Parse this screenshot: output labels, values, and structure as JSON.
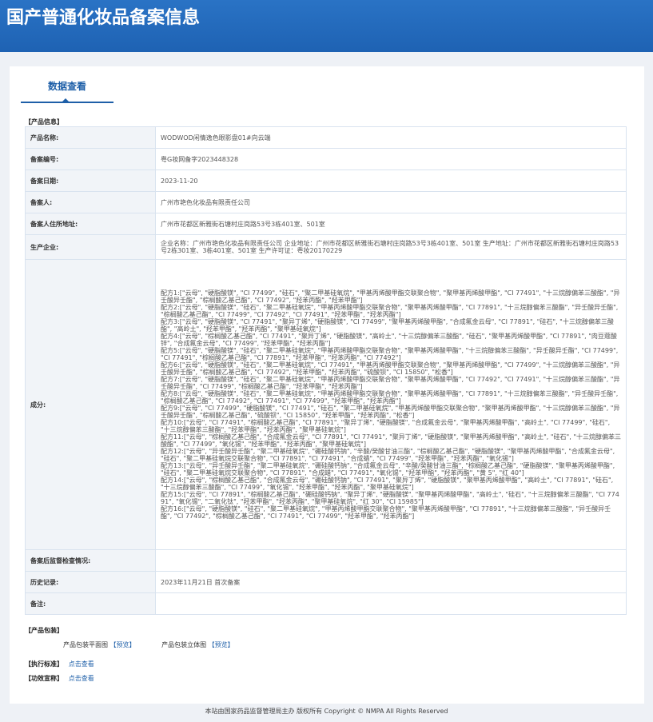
{
  "header": {
    "title": "国产普通化妆品备案信息"
  },
  "tab": {
    "label": "数据查看"
  },
  "sections": {
    "product_info": "【产品信息】",
    "product_package": "【产品包装】",
    "exec_standard": "【执行标准】",
    "efficacy": "【功效宣称】"
  },
  "rows": {
    "product_name": {
      "label": "产品名称:",
      "value": "WODWOD闲情逸色眼影盘01#向云端"
    },
    "record_no": {
      "label": "备案编号:",
      "value": "粤G妆网备字2023448328"
    },
    "record_date": {
      "label": "备案日期:",
      "value": "2023-11-20"
    },
    "registrant": {
      "label": "备案人:",
      "value": "广州市艳色化妆品有限责任公司"
    },
    "registrant_address": {
      "label": "备案人住所地址:",
      "value": "广州市花都区新雅街石塘村庄岗路53号3栋401室、501室"
    },
    "manufacturer": {
      "label": "生产企业:",
      "value": "企业名称：广州市艳色化妆品有限责任公司 企业地址：广州市花都区新雅街石塘村庄岗路53号3栋401室、501室 生产地址：广州市花都区新雅街石塘村庄岗路53号2栋301室、3栋401室、501室 生产许可证：粤妆20170229"
    },
    "ingredients": {
      "label": "成分:",
      "value": "配方1:[\"云母\", \"硬脂酸镁\", \"CI 77499\", \"硅石\", \"聚二甲基硅氧烷\", \"甲基丙烯酸甲酯交联聚合物\", \"聚甲基丙烯酸甲酯\", \"CI 77491\", \"十三烷醇偏苯三酸酯\", \"异壬酸异壬酯\", \"棕榈酸乙基己酯\", \"CI 77492\", \"羟苯丙酯\", \"羟苯甲酯\"]\n配方2:[\"云母\", \"硬脂酸镁\", \"硅石\", \"聚二甲基硅氧烷\", \"甲基丙烯酸甲酯交联聚合物\", \"聚甲基丙烯酸甲酯\", \"CI 77891\", \"十三烷醇偏苯三酸酯\", \"异壬酸异壬酯\", \"棕榈酸乙基己酯\", \"CI 77499\", \"CI 77492\", \"CI 77491\", \"羟苯甲酯\", \"羟苯丙酯\"]\n配方3:[\"云母\", \"硬脂酸镁\", \"CI 77491\", \"聚异丁烯\", \"硬脂酸镁\", \"CI 77499\", \"聚甲基丙烯酸甲酯\", \"合成氟金云母\", \"CI 77891\", \"硅石\", \"十三烷醇偏苯三酸酯\", \"高岭土\", \"羟苯甲酯\", \"羟苯丙酯\", \"聚甲基硅氧烷\"]\n配方4:[\"云母\", \"棕榈酸乙基己酯\", \"CI 77491\", \"聚异丁烯\", \"硬脂酸镁\", \"高岭土\", \"十三烷醇偏苯三酸酯\", \"硅石\", \"聚甲基丙烯酸甲酯\", \"CI 77891\", \"肉豆蔻酸锌\", \"合成氟金云母\", \"CI 77499\", \"羟苯甲酯\", \"羟苯丙酯\"]\n配方5:[\"云母\", \"硬脂酸镁\", \"硅石\", \"聚二甲基硅氧烷\", \"甲基丙烯酸甲酯交联聚合物\", \"聚甲基丙烯酸甲酯\", \"十三烷醇偏苯三酸酯\", \"异壬酸异壬酯\", \"CI 77499\", \"CI 77491\", \"棕榈酸乙基己酯\", \"CI 77891\", \"羟苯甲酯\", \"羟苯丙酯\", \"CI 77492\"]\n配方6:[\"云母\", \"硬脂酸镁\", \"硅石\", \"聚二甲基硅氧烷\", \"CI 77491\", \"甲基丙烯酸甲酯交联聚合物\", \"聚甲基丙烯酸甲酯\", \"CI 77499\", \"十三烷醇偏苯三酸酯\", \"异壬酸异壬酯\", \"棕榈酸乙基己酯\", \"CI 77492\", \"羟苯甲酯\", \"羟苯丙酯\", \"硫酸钡\", \"CI 15850\", \"松香\"]\n配方7:[\"云母\", \"硬脂酸镁\", \"硅石\", \"聚二甲基硅氧烷\", \"甲基丙烯酸甲酯交联聚合物\", \"聚甲基丙烯酸甲酯\", \"CI 77492\", \"CI 77491\", \"十三烷醇偏苯三酸酯\", \"异壬酸异壬酯\", \"CI 77499\", \"棕榈酸乙基己酯\", \"羟苯甲酯\", \"羟苯丙酯\"]\n配方8:[\"云母\", \"硬脂酸镁\", \"硅石\", \"聚二甲基硅氧烷\", \"甲基丙烯酸甲酯交联聚合物\", \"聚甲基丙烯酸甲酯\", \"CI 77891\", \"十三烷醇偏苯三酸酯\", \"异壬酸异壬酯\", \"棕榈酸乙基己酯\", \"CI 77492\", \"CI 77491\", \"CI 77499\", \"羟苯甲酯\", \"羟苯丙酯\"]\n配方9:[\"云母\", \"CI 77499\", \"硬脂酸镁\", \"CI 77491\", \"硅石\", \"聚二甲基硅氧烷\", \"甲基丙烯酸甲酯交联聚合物\", \"聚甲基丙烯酸甲酯\", \"十三烷醇偏苯三酸酯\", \"异壬酸异壬酯\", \"棕榈酸乙基己酯\", \"硫酸钡\", \"CI 15850\", \"羟苯甲酯\", \"羟苯丙酯\", \"松香\"]\n配方10:[\"云母\", \"CI 77491\", \"棕榈酸乙基己酯\", \"CI 77891\", \"聚异丁烯\", \"硬脂酸镁\", \"合成氟金云母\", \"聚甲基丙烯酸甲酯\", \"高岭土\", \"CI 77499\", \"硅石\", \"十三烷醇偏苯三酸酯\", \"羟苯甲酯\", \"羟苯丙酯\", \"聚甲基硅氧烷\"]\n配方11:[\"云母\", \"棕榈酸乙基己酯\", \"合成氟金云母\", \"CI 77891\", \"CI 77491\", \"聚异丁烯\", \"硬脂酸镁\", \"聚甲基丙烯酸甲酯\", \"高岭土\", \"硅石\", \"十三烷醇偏苯三酸酯\", \"CI 77499\", \"氧化锡\", \"羟苯甲酯\", \"羟苯丙酯\", \"聚甲基硅氧烷\"]\n配方12:[\"云母\", \"异壬酸异壬酯\", \"聚二甲基硅氧烷\", \"硼硅酸钙钠\", \"辛酸/癸酸甘油三酯\", \"棕榈酸乙基己酯\", \"硬脂酸镁\", \"聚甲基丙烯酸甲酯\", \"合成氟金云母\", \"硅石\", \"聚二甲基硅氧烷交联聚合物\", \"CI 77891\", \"CI 77491\", \"合成蜡\", \"CI 77499\", \"羟苯甲酯\", \"羟苯丙酯\", \"氧化锡\"]\n配方13:[\"云母\", \"异壬酸异壬酯\", \"聚二甲基硅氧烷\", \"硼硅酸钙钠\", \"合成氟金云母\", \"辛酸/癸酸甘油三酯\", \"棕榈酸乙基己酯\", \"硬脂酸镁\", \"聚甲基丙烯酸甲酯\", \"硅石\", \"聚二甲基硅氧烷交联聚合物\", \"CI 77891\", \"合成蜡\", \"CI 77491\", \"氧化锡\", \"羟苯甲酯\", \"羟苯丙酯\", \"黄 5\", \"红 40\"]\n配方14:[\"云母\", \"棕榈酸乙基己酯\", \"合成氟金云母\", \"硼硅酸钙钠\", \"CI 77491\", \"聚异丁烯\", \"硬脂酸镁\", \"聚甲基丙烯酸甲酯\", \"高岭土\", \"CI 77891\", \"硅石\", \"十三烷醇偏苯三酸酯\", \"CI 77499\", \"氧化锡\", \"羟苯甲酯\", \"羟苯丙酯\", \"聚甲基硅氧烷\"]\n配方15:[\"云母\", \"CI 77891\", \"棕榈酸乙基己酯\", \"硼硅酸钙钠\", \"聚异丁烯\", \"硬脂酸镁\", \"聚甲基丙烯酸甲酯\", \"高岭土\", \"硅石\", \"十三烷醇偏苯三酸酯\", \"CI 77491\", \"氧化锡\", \"二氧化钛\", \"羟苯甲酯\", \"羟苯丙酯\", \"聚甲基硅氧烷\", \"红 30\", \"CI 15985\"]\n配方16:[\"云母\", \"硬脂酸镁\", \"硅石\", \"聚二甲基硅氧烷\", \"甲基丙烯酸甲酯交联聚合物\", \"聚甲基丙烯酸甲酯\", \"CI 77891\", \"十三烷醇偏苯三酸酯\", \"异壬酸异壬酯\", \"CI 77492\", \"棕榈酸乙基己酯\", \"CI 77491\", \"CI 77499\", \"羟苯甲酯\", \"羟苯丙酯\"]"
    },
    "post_inspection": {
      "label": "备案后监督检查情况:",
      "value": ""
    },
    "history": {
      "label": "历史记录:",
      "value": "2023年11月21日 首次备案"
    },
    "remarks": {
      "label": "备注:",
      "value": ""
    }
  },
  "package": {
    "flat_label": "产品包装平面图",
    "flat_link": "【预览】",
    "stereo_label": "产品包装立体图",
    "stereo_link": "【预览】"
  },
  "links": {
    "view_label": "点击查看"
  },
  "footer": {
    "text": "本站由国家药品监督管理局主办 版权所有 Copyright © NMPA All Rights Reserved"
  }
}
